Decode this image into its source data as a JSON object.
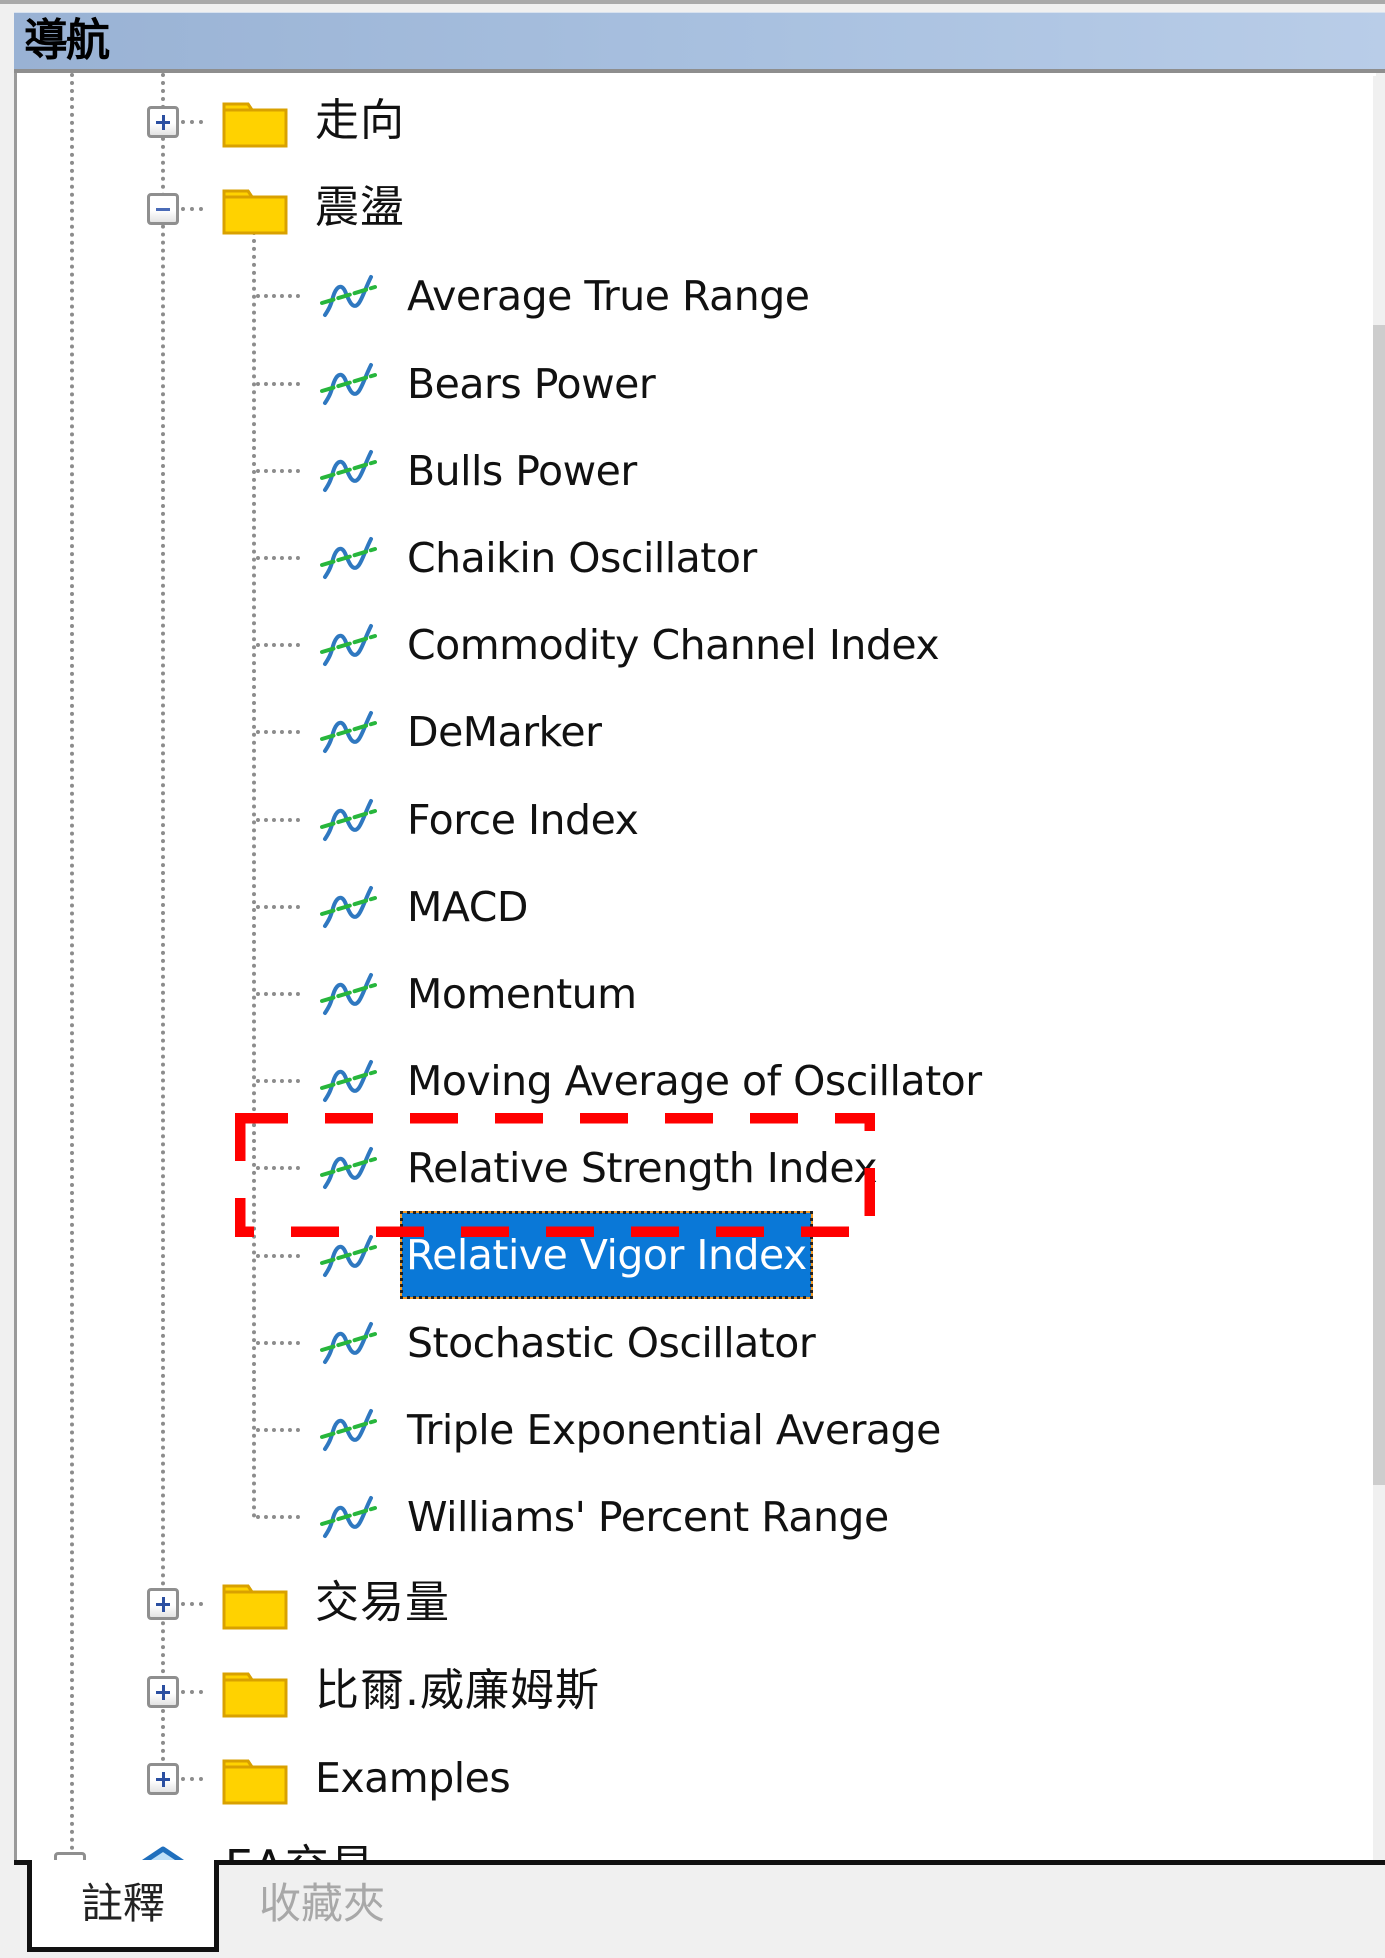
{
  "panel": {
    "title": "導航"
  },
  "tree": {
    "groups_before": [
      {
        "label": "走向",
        "expanded": false,
        "icon": "folder-icon"
      },
      {
        "label": "震盪",
        "expanded": true,
        "icon": "folder-icon"
      }
    ],
    "indicators": [
      {
        "label": "Average True Range",
        "icon": "indicator-icon"
      },
      {
        "label": "Bears Power",
        "icon": "indicator-icon"
      },
      {
        "label": "Bulls Power",
        "icon": "indicator-icon"
      },
      {
        "label": "Chaikin Oscillator",
        "icon": "indicator-icon"
      },
      {
        "label": "Commodity Channel Index",
        "icon": "indicator-icon"
      },
      {
        "label": "DeMarker",
        "icon": "indicator-icon"
      },
      {
        "label": "Force Index",
        "icon": "indicator-icon"
      },
      {
        "label": "MACD",
        "icon": "indicator-icon"
      },
      {
        "label": "Momentum",
        "icon": "indicator-icon"
      },
      {
        "label": "Moving Average of Oscillator",
        "icon": "indicator-icon"
      },
      {
        "label": "Relative Strength Index",
        "icon": "indicator-icon"
      },
      {
        "label": "Relative Vigor Index",
        "icon": "indicator-icon",
        "selected": true,
        "highlighted": true
      },
      {
        "label": "Stochastic Oscillator",
        "icon": "indicator-icon"
      },
      {
        "label": "Triple Exponential Average",
        "icon": "indicator-icon"
      },
      {
        "label": "Williams' Percent Range",
        "icon": "indicator-icon"
      }
    ],
    "groups_after": [
      {
        "label": "交易量",
        "expanded": false,
        "icon": "folder-icon"
      },
      {
        "label": "比爾.威廉姆斯",
        "expanded": false,
        "icon": "folder-icon"
      },
      {
        "label": "Examples",
        "expanded": false,
        "icon": "folder-icon"
      }
    ],
    "partial_item": {
      "label": "EA交易",
      "icon": "expert-advisor-icon"
    },
    "selected_item": "Relative Vigor Index"
  },
  "tabs": [
    {
      "label": "註釋",
      "active": true
    },
    {
      "label": "收藏夾",
      "active": false
    }
  ],
  "colors": {
    "selection": "#0a78d7",
    "annotation": "#ff0000",
    "folder": "#ffd200",
    "folder_edge": "#d9a100",
    "header_gradient_start": "#99b2d4",
    "header_gradient_end": "#b9cde8"
  }
}
